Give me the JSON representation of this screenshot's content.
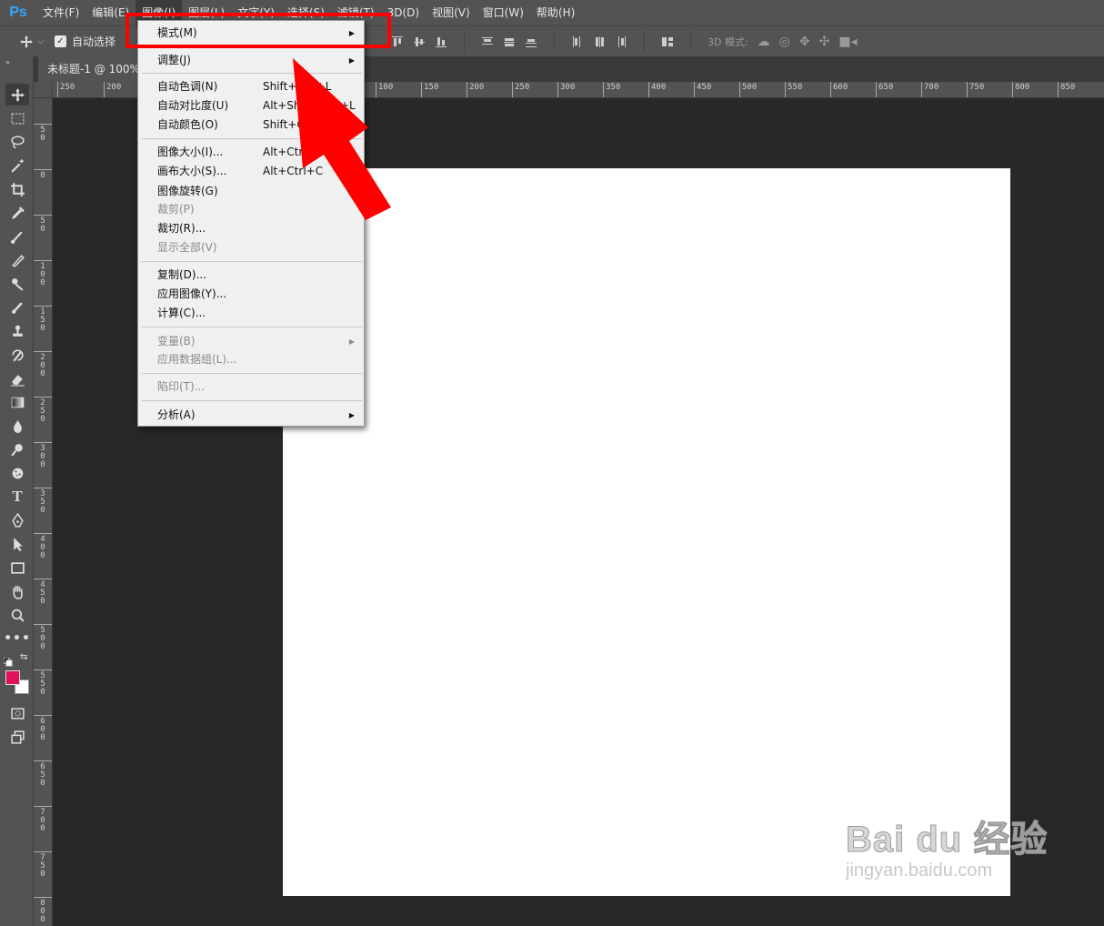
{
  "app": {
    "logo": "Ps"
  },
  "menubar": {
    "items": [
      {
        "label": "文件(F)"
      },
      {
        "label": "编辑(E)"
      },
      {
        "label": "图像(I)"
      },
      {
        "label": "图层(L)"
      },
      {
        "label": "文字(Y)"
      },
      {
        "label": "选择(S)"
      },
      {
        "label": "滤镜(T)"
      },
      {
        "label": "3D(D)"
      },
      {
        "label": "视图(V)"
      },
      {
        "label": "窗口(W)"
      },
      {
        "label": "帮助(H)"
      }
    ],
    "active_index": 2
  },
  "options_bar": {
    "auto_select_label": "自动选择",
    "mode_3d_label": "3D 模式:"
  },
  "document_tab": {
    "title": "未标题-1 @ 100%"
  },
  "ruler": {
    "h_labels": [
      "250",
      "200",
      "100",
      "150",
      "200",
      "250",
      "300",
      "350",
      "400",
      "450",
      "500",
      "550",
      "600",
      "650",
      "700",
      "750",
      "800",
      "850"
    ],
    "v_labels": [
      "5\n0",
      "0",
      "5\n0",
      "1\n0\n0",
      "1\n5\n0",
      "2\n0\n0",
      "2\n5\n0",
      "3\n0\n0",
      "3\n5\n0",
      "4\n0\n0",
      "4\n5\n0",
      "5\n0\n0",
      "5\n5\n0",
      "6\n0\n0",
      "6\n5\n0",
      "7\n0\n0",
      "7\n5\n0",
      "8\n0\n0"
    ]
  },
  "image_menu": {
    "items": [
      {
        "label": "模式(M)",
        "submenu": true
      },
      {
        "label": "调整(J)",
        "submenu": true
      },
      {
        "label": "自动色调(N)",
        "shortcut": "Shift+Ctrl+L"
      },
      {
        "label": "自动对比度(U)",
        "shortcut": "Alt+Shift+Ctrl+L"
      },
      {
        "label": "自动颜色(O)",
        "shortcut": "Shift+Ctrl+B"
      },
      {
        "label": "图像大小(I)...",
        "shortcut": "Alt+Ctrl+I"
      },
      {
        "label": "画布大小(S)...",
        "shortcut": "Alt+Ctrl+C"
      },
      {
        "label": "图像旋转(G)",
        "submenu": true
      },
      {
        "label": "裁剪(P)",
        "disabled": true
      },
      {
        "label": "裁切(R)..."
      },
      {
        "label": "显示全部(V)",
        "disabled": true
      },
      {
        "label": "复制(D)..."
      },
      {
        "label": "应用图像(Y)..."
      },
      {
        "label": "计算(C)..."
      },
      {
        "label": "变量(B)",
        "disabled": true,
        "submenu": true
      },
      {
        "label": "应用数据组(L)...",
        "disabled": true
      },
      {
        "label": "陷印(T)...",
        "disabled": true
      },
      {
        "label": "分析(A)",
        "submenu": true
      }
    ]
  },
  "colors": {
    "foreground": "#e0105a",
    "background": "#ffffff",
    "highlight": "#ff0000"
  },
  "watermark": {
    "line1": "Bai du 经验",
    "line2": "jingyan.baidu.com"
  }
}
